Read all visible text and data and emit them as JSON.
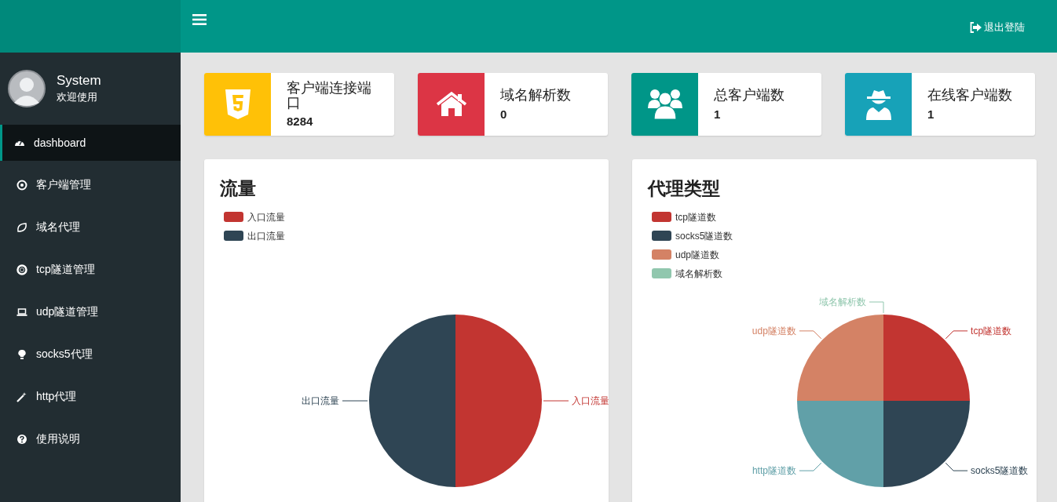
{
  "header": {
    "logout": "退出登陆"
  },
  "user": {
    "name": "System",
    "greeting": "欢迎使用"
  },
  "sidebar": {
    "items": [
      {
        "label": "dashboard",
        "selected": true
      },
      {
        "label": "客户端管理",
        "selected": false
      },
      {
        "label": "域名代理",
        "selected": false
      },
      {
        "label": "tcp隧道管理",
        "selected": false
      },
      {
        "label": "udp隧道管理",
        "selected": false
      },
      {
        "label": "socks5代理",
        "selected": false
      },
      {
        "label": "http代理",
        "selected": false
      },
      {
        "label": "使用说明",
        "selected": false
      }
    ]
  },
  "stats": [
    {
      "label": "客户端连接端口",
      "value": "8284",
      "color": "#ffc107"
    },
    {
      "label": "域名解析数",
      "value": "0",
      "color": "#dc3545"
    },
    {
      "label": "总客户端数",
      "value": "1",
      "color": "#009688"
    },
    {
      "label": "在线客户端数",
      "value": "1",
      "color": "#17a2b8"
    }
  ],
  "panels": [
    {
      "title": "流量",
      "legend": [
        {
          "label": "入口流量",
          "color": "#c23531"
        },
        {
          "label": "出口流量",
          "color": "#2f4554"
        }
      ],
      "chart_data": {
        "type": "pie",
        "categories": [
          "入口流量",
          "出口流量"
        ],
        "values": [
          50,
          50
        ],
        "colors": [
          "#c23531",
          "#2f4554"
        ]
      }
    },
    {
      "title": "代理类型",
      "legend": [
        {
          "label": "tcp隧道数",
          "color": "#c23531"
        },
        {
          "label": "socks5隧道数",
          "color": "#2f4554"
        },
        {
          "label": "udp隧道数",
          "color": "#d48265"
        },
        {
          "label": "域名解析数",
          "color": "#91c7ae"
        }
      ],
      "chart_data": {
        "type": "pie",
        "categories": [
          "tcp隧道数",
          "socks5隧道数",
          "http隧道数",
          "udp隧道数",
          "域名解析数"
        ],
        "values": [
          25,
          25,
          25,
          25,
          0
        ],
        "colors": [
          "#c23531",
          "#2f4554",
          "#61a0a8",
          "#d48265",
          "#91c7ae"
        ]
      }
    }
  ]
}
